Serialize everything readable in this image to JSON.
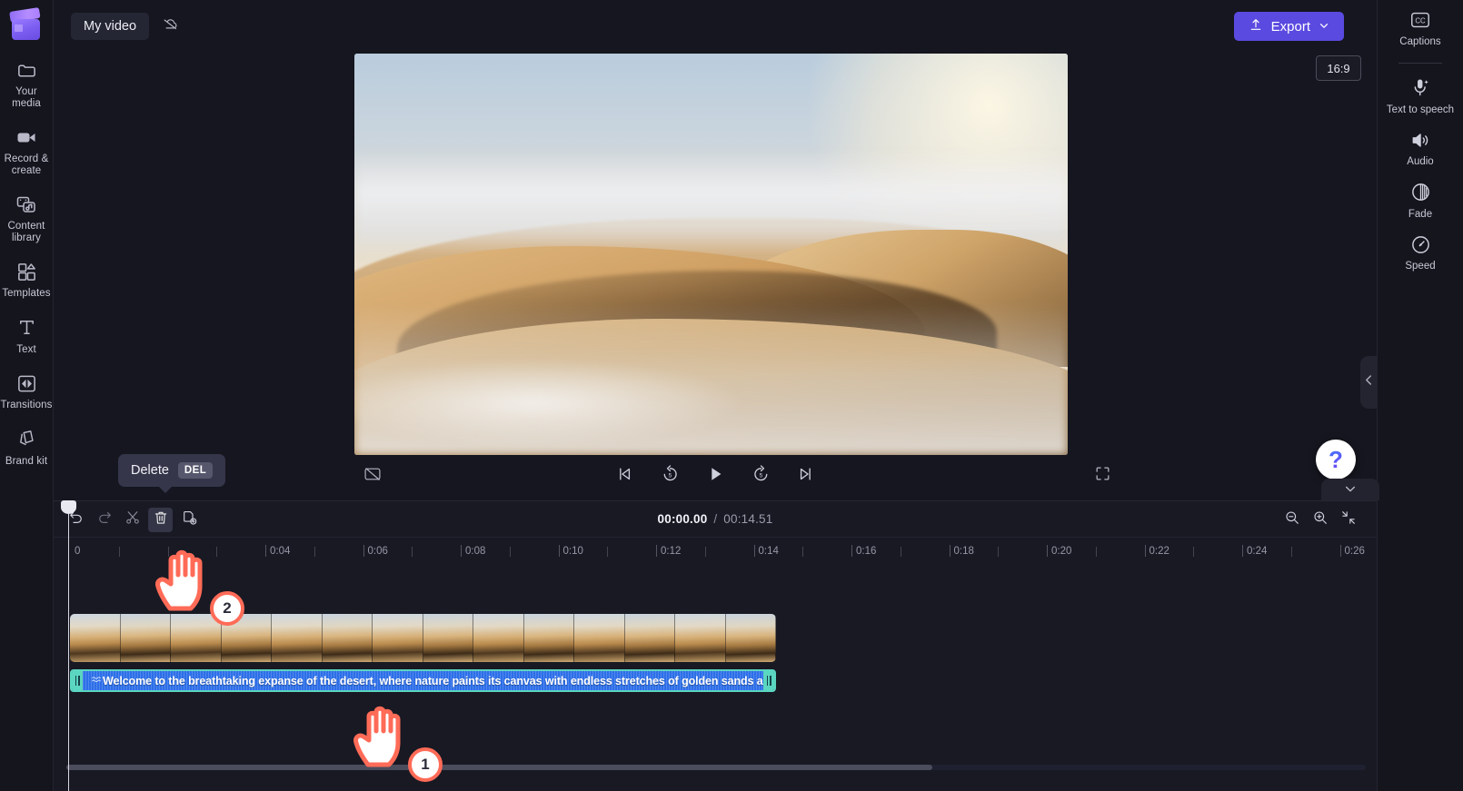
{
  "app": {
    "title": "My video",
    "logo_icon": "clapperboard-icon",
    "cloud_off_icon": "cloud-off-icon"
  },
  "top_bar": {
    "export_label": "Export",
    "export_icon": "upload-icon",
    "export_chevron_icon": "chevron-down-icon",
    "export_color": "#5b4ae0"
  },
  "left_rail": {
    "items": [
      {
        "label": "Your media",
        "icon": "folder-icon"
      },
      {
        "label": "Record & create",
        "icon": "video-camera-icon"
      },
      {
        "label": "Content library",
        "icon": "media-library-icon"
      },
      {
        "label": "Templates",
        "icon": "templates-grid-icon"
      },
      {
        "label": "Text",
        "icon": "text-t-icon"
      },
      {
        "label": "Transitions",
        "icon": "transitions-icon"
      },
      {
        "label": "Brand kit",
        "icon": "brand-kit-icon"
      }
    ],
    "expand_icon": "chevron-right-icon"
  },
  "right_rail": {
    "items": [
      {
        "label": "Captions",
        "icon": "closed-captions-icon"
      },
      {
        "label": "Text to speech",
        "icon": "microphone-sparkle-icon"
      },
      {
        "label": "Audio",
        "icon": "speaker-icon"
      },
      {
        "label": "Fade",
        "icon": "fade-circle-icon"
      },
      {
        "label": "Speed",
        "icon": "speedometer-icon"
      }
    ]
  },
  "preview": {
    "aspect_ratio": "16:9",
    "cc_off_icon": "captions-off-icon",
    "fullscreen_icon": "fullscreen-icon",
    "collapse_icon": "chevron-left-icon",
    "help_label": "?",
    "transport": [
      {
        "name": "skip-to-start-button",
        "icon": "skip-previous-icon"
      },
      {
        "name": "rewind-5-button",
        "icon": "replay-5-icon",
        "label": "5"
      },
      {
        "name": "play-button",
        "icon": "play-icon"
      },
      {
        "name": "forward-5-button",
        "icon": "forward-5-icon",
        "label": "5"
      },
      {
        "name": "skip-to-end-button",
        "icon": "skip-next-icon"
      }
    ]
  },
  "timeline": {
    "toolbar": [
      {
        "name": "undo-button",
        "icon": "undo-arrow-icon",
        "active": false
      },
      {
        "name": "redo-button",
        "icon": "redo-arrow-icon",
        "active": false
      },
      {
        "name": "split-button",
        "icon": "scissors-icon",
        "active": false
      },
      {
        "name": "delete-button",
        "icon": "trash-icon",
        "active": true
      },
      {
        "name": "duplicate-button",
        "icon": "duplicate-icon",
        "active": false
      }
    ],
    "current_time": "00:00.00",
    "separator": "/",
    "total_time": "00:14.51",
    "zoom_out_icon": "zoom-out-icon",
    "zoom_in_icon": "zoom-in-icon",
    "fit_icon": "fit-to-screen-icon",
    "collapse_icon": "chevron-down-icon",
    "ruler_labels": [
      "0",
      "0:04",
      "0:06",
      "0:08",
      "0:10",
      "0:12",
      "0:14",
      "0:16",
      "0:18",
      "0:20",
      "0:22",
      "0:24",
      "0:26"
    ],
    "caption_clip": {
      "text": "Welcome to the breathtaking expanse of the desert, where nature paints its canvas with endless stretches of golden sands and boundless",
      "icon": "audio-wave-icon",
      "fill_color": "#2d6fe8",
      "selection_color": "#5bd6c0"
    }
  },
  "tooltip": {
    "label": "Delete",
    "shortcut": "DEL"
  },
  "markers": [
    {
      "number": "1",
      "name": "cursor-marker-caption-clip"
    },
    {
      "number": "2",
      "name": "cursor-marker-delete-button"
    }
  ]
}
